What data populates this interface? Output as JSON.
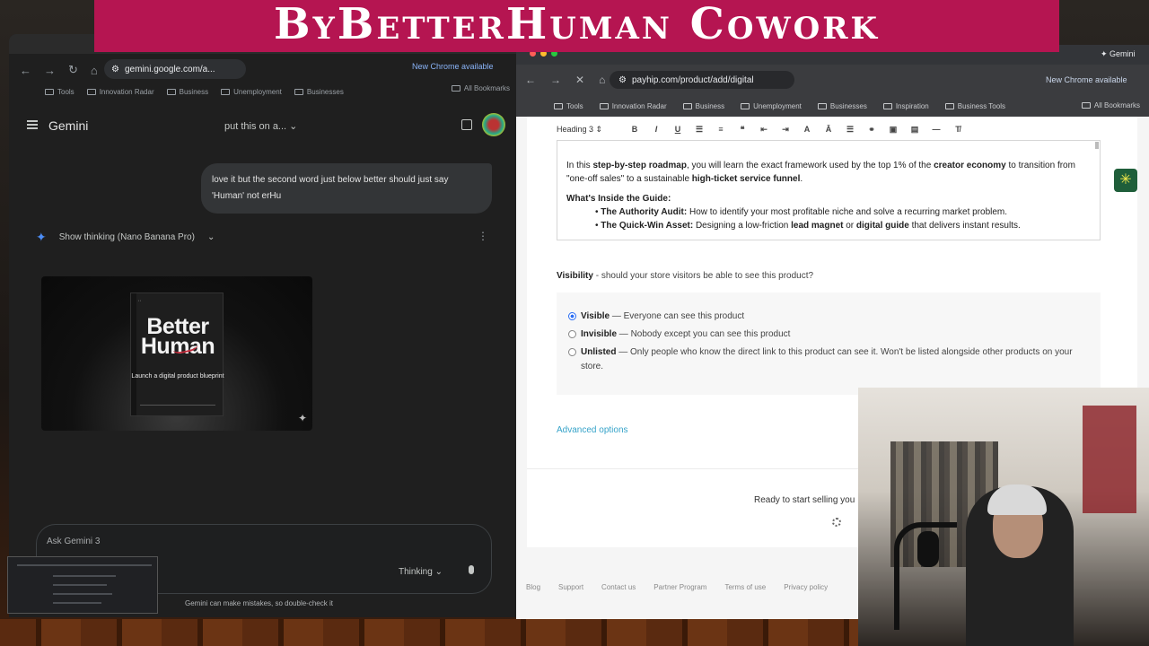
{
  "banner": {
    "title": "ByBetterHuman Cowork"
  },
  "left_window": {
    "url": "gemini.google.com/a...",
    "new_chrome": "New Chrome available",
    "bookmarks": [
      "Tools",
      "Innovation Radar",
      "Business",
      "Unemployment",
      "Businesses"
    ],
    "all_bookmarks": "All Bookmarks",
    "app_name": "Gemini",
    "chat_title": "put this on a...",
    "user_message": "love it but the second word just below better should just say 'Human' not erHu",
    "thinking_label": "Show thinking (Nano Banana Pro)",
    "book": {
      "title": "Better Human",
      "subtitle": "Launch a digital product blueprint"
    },
    "input_placeholder": "Ask Gemini 3",
    "mode": "Thinking",
    "disclaimer": "Gemini can make mistakes, so double-check it"
  },
  "right_window": {
    "url": "payhip.com/product/add/digital",
    "new_chrome": "New Chrome available",
    "tab_label": "Gemini",
    "bookmarks": [
      "Tools",
      "Innovation Radar",
      "Business",
      "Unemployment",
      "Businesses",
      "Inspiration",
      "Business Tools"
    ],
    "all_bookmarks": "All Bookmarks",
    "editor": {
      "block_style": "Heading 3",
      "p1_a": "In this ",
      "p1_b": "step-by-step roadmap",
      "p1_c": ", you will learn the exact framework used by the top 1% of the ",
      "p1_d": "creator economy",
      "p1_e": " to transition from \"one-off sales\" to a sustainable ",
      "p1_f": "high-ticket service funnel",
      "p1_g": ".",
      "heading": "What's Inside the Guide:",
      "b1_label": "The Authority Audit:",
      "b1_text": " How to identify your most profitable niche and solve a recurring market problem.",
      "b2_label": "The Quick-Win Asset:",
      "b2_a": " Designing a low-friction ",
      "b2_b": "lead magnet",
      "b2_c": " or ",
      "b2_d": "digital guide",
      "b2_e": " that delivers instant results."
    },
    "visibility": {
      "label": "Visibility",
      "question": " - should your store visitors be able to see this product?",
      "options": [
        {
          "name": "Visible",
          "desc": " — Everyone can see this product",
          "selected": true
        },
        {
          "name": "Invisible",
          "desc": " — Nobody except you can see this product",
          "selected": false
        },
        {
          "name": "Unlisted",
          "desc": " — Only people who know the direct link to this product can see it. Won't be listed alongside other products on your store.",
          "selected": false
        }
      ]
    },
    "advanced": "Advanced options",
    "ready_text": "Ready to start selling you",
    "footer": [
      "Blog",
      "Support",
      "Contact us",
      "Partner Program",
      "Terms of use",
      "Privacy policy"
    ]
  },
  "colors": {
    "banner": "#b51551",
    "link": "#36a3c9",
    "radio": "#2a6df4"
  }
}
